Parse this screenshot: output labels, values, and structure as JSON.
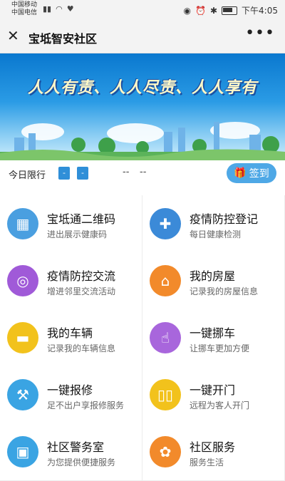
{
  "status": {
    "carrier1": "中国移动",
    "carrier2": "中国电信",
    "time": "下午4:05"
  },
  "header": {
    "title": "宝坻智安社区",
    "more": "•••",
    "close": "✕"
  },
  "banner": {
    "slogan": "人人有责、人人尽责、人人享有"
  },
  "limit": {
    "label": "今日限行",
    "plate1": "-",
    "plate2": "-",
    "dash1": "--",
    "dash2": "--",
    "checkin_label": "签到"
  },
  "services": [
    {
      "title": "宝坻通二维码",
      "sub": "进出展示健康码",
      "icon": "qrcode-icon",
      "color": "#4a9fe0"
    },
    {
      "title": "疫情防控登记",
      "sub": "每日健康检测",
      "icon": "shield-plus-icon",
      "color": "#3b8ad8"
    },
    {
      "title": "疫情防控交流",
      "sub": "增进邻里交流活动",
      "icon": "camera-aperture-icon",
      "color": "#a05ad8"
    },
    {
      "title": "我的房屋",
      "sub": "记录我的房屋信息",
      "icon": "house-icon",
      "color": "#f28a2b"
    },
    {
      "title": "我的车辆",
      "sub": "记录我的车辆信息",
      "icon": "car-icon",
      "color": "#f2c21c"
    },
    {
      "title": "一键挪车",
      "sub": "让挪车更加方便",
      "icon": "tap-hand-icon",
      "color": "#a866dc"
    },
    {
      "title": "一键报修",
      "sub": "足不出户享报修服务",
      "icon": "wrench-house-icon",
      "color": "#3aa4e3"
    },
    {
      "title": "一键开门",
      "sub": "远程为客人开门",
      "icon": "door-icon",
      "color": "#f2c21c"
    },
    {
      "title": "社区警务室",
      "sub": "为您提供便捷服务",
      "icon": "police-station-icon",
      "color": "#3aa4e3"
    },
    {
      "title": "社区服务",
      "sub": "服务生活",
      "icon": "flower-icon",
      "color": "#f28a2b"
    }
  ]
}
